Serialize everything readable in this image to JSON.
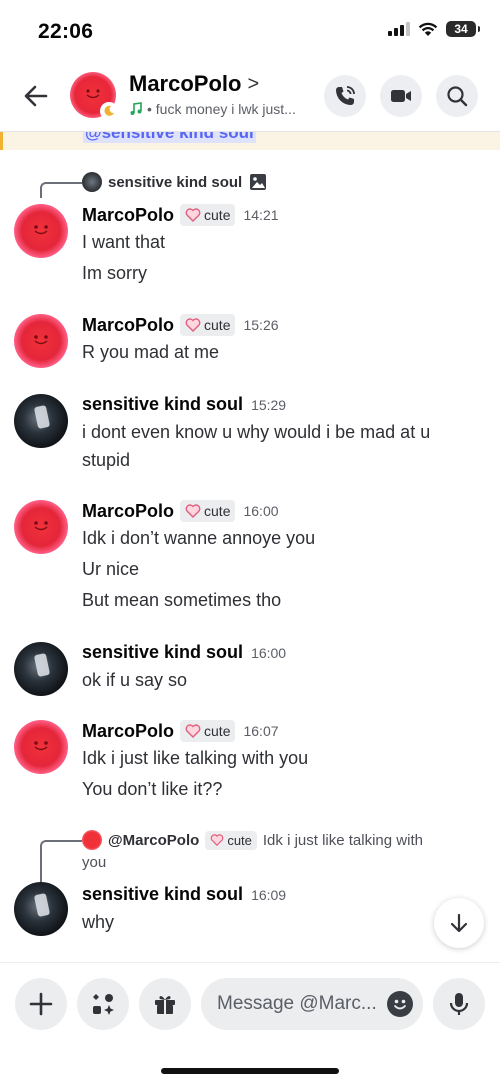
{
  "status_bar": {
    "time": "22:06",
    "battery": "34"
  },
  "header": {
    "name": "MarcoPolo",
    "chevron": ">",
    "status_text": "• fuck money i lwk just..."
  },
  "top_highlight": "@sensitive kind soul",
  "messages": [
    {
      "reply_to": {
        "author": "sensitive kind soul"
      },
      "author": "MarcoPolo",
      "tag": "cute",
      "time": "14:21",
      "lines": [
        "I want that",
        "Im sorry"
      ]
    },
    {
      "author": "MarcoPolo",
      "tag": "cute",
      "time": "15:26",
      "lines": [
        "R you mad at me"
      ]
    },
    {
      "author": "sensitive kind soul",
      "time": "15:29",
      "lines": [
        "i dont even know u why would i be mad at u",
        "stupid"
      ]
    },
    {
      "author": "MarcoPolo",
      "tag": "cute",
      "time": "16:00",
      "lines": [
        "Idk i don’t wanne annoye you",
        "Ur nice",
        "But mean sometimes tho"
      ]
    },
    {
      "author": "sensitive kind soul",
      "time": "16:00",
      "lines": [
        "ok if u say so"
      ]
    },
    {
      "author": "MarcoPolo",
      "tag": "cute",
      "time": "16:07",
      "lines": [
        "Idk i just like talking with you",
        "You don’t like it??"
      ]
    },
    {
      "reply_to": {
        "author": "@MarcoPolo",
        "tag": "cute",
        "preview_1": "Idk i just like talking with",
        "preview_2": "you"
      },
      "author": "sensitive kind soul",
      "time": "16:09",
      "lines": [
        "why"
      ]
    }
  ],
  "composer": {
    "placeholder": "Message @Marc..."
  },
  "colors": {
    "accent": "#5865f2",
    "highlight": "#fbf3e4",
    "marco_avatar": "#e4263a"
  },
  "icons": [
    "back-arrow-icon",
    "phone-call-icon",
    "video-camera-icon",
    "search-icon",
    "music-note-icon",
    "moon-icon",
    "image-icon",
    "heart-icon",
    "arrow-down-icon",
    "plus-icon",
    "apps-icon",
    "gift-icon",
    "emoji-icon",
    "microphone-icon"
  ]
}
